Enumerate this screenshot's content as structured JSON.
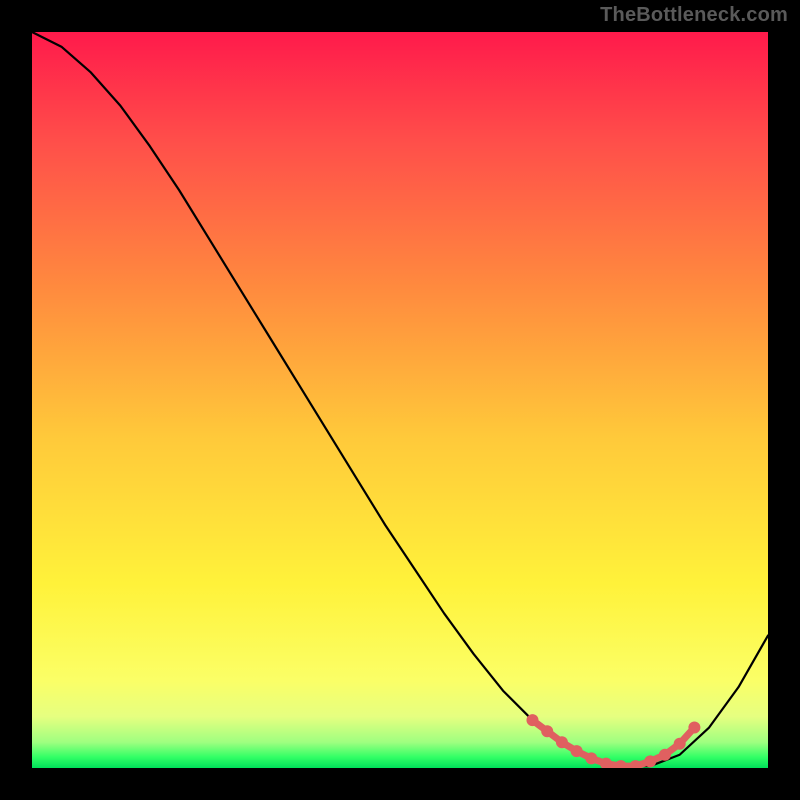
{
  "watermark": "TheBottleneck.com",
  "chart_data": {
    "type": "line",
    "title": "",
    "xlabel": "",
    "ylabel": "",
    "xlim": [
      0,
      100
    ],
    "ylim": [
      0,
      100
    ],
    "grid": false,
    "legend": false,
    "gradient_stops": [
      {
        "offset": 0.0,
        "color": "#ff1a4b"
      },
      {
        "offset": 0.15,
        "color": "#ff4f4a"
      },
      {
        "offset": 0.35,
        "color": "#ff8b3e"
      },
      {
        "offset": 0.55,
        "color": "#ffc93a"
      },
      {
        "offset": 0.75,
        "color": "#fff23a"
      },
      {
        "offset": 0.88,
        "color": "#fbff66"
      },
      {
        "offset": 0.93,
        "color": "#e6ff80"
      },
      {
        "offset": 0.965,
        "color": "#9fff80"
      },
      {
        "offset": 0.985,
        "color": "#33ff66"
      },
      {
        "offset": 1.0,
        "color": "#00e05a"
      }
    ],
    "series": [
      {
        "name": "curve",
        "x": [
          0,
          4,
          8,
          12,
          16,
          20,
          24,
          28,
          32,
          36,
          40,
          44,
          48,
          52,
          56,
          60,
          64,
          68,
          72,
          76,
          80,
          84,
          88,
          92,
          96,
          100
        ],
        "y": [
          100,
          98,
          94.5,
          90,
          84.5,
          78.5,
          72,
          65.5,
          59,
          52.5,
          46,
          39.5,
          33,
          27,
          21,
          15.5,
          10.5,
          6.5,
          3.5,
          1.3,
          0.25,
          0.25,
          1.8,
          5.5,
          11,
          18
        ],
        "stroke": "#000000",
        "stroke_width": 2.2
      },
      {
        "name": "marker-band",
        "x": [
          68,
          70,
          72,
          74,
          76,
          78,
          80,
          82,
          84,
          86,
          88,
          90
        ],
        "y": [
          6.5,
          5.0,
          3.5,
          2.3,
          1.3,
          0.6,
          0.25,
          0.25,
          0.9,
          1.8,
          3.3,
          5.5
        ],
        "stroke": "#e06060",
        "stroke_width": 7,
        "marker_color": "#e06060",
        "marker_r": 6
      }
    ]
  }
}
